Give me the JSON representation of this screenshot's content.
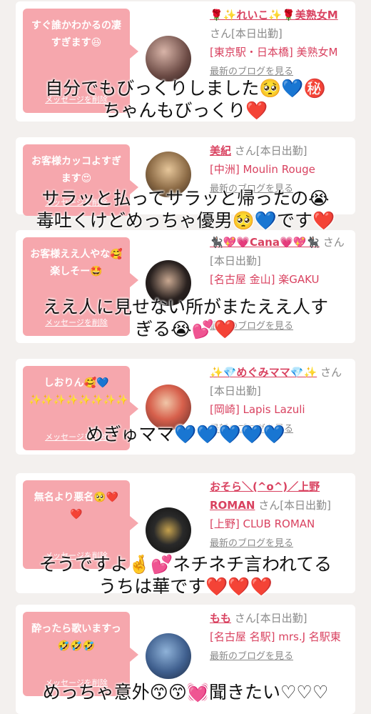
{
  "cards": [
    {
      "bubble": "すぐ誰かわかるの凄すぎます😆",
      "delete": "メッセージを削除",
      "name": "🌹✨れいこ✨🌹美熟女M",
      "suffix": "さん[本日出勤]",
      "location": "[東京駅・日本橋] 美熟女M",
      "blog": "最新のブログを見る"
    },
    {
      "bubble": "お客様カッコよすぎます😍",
      "delete": "メッセージを削除",
      "name": "美紀",
      "suffix": "さん[本日出勤]",
      "location": "[中洲] Moulin Rouge",
      "blog": "最新のブログを見る"
    },
    {
      "bubble": "お客様ええ人やな🥰楽しそー🤩",
      "delete": "メッセージを削除",
      "name": "🐈‍⬛💖💗Cana💗💖🐈‍⬛",
      "suffix": "さん[本日出勤]",
      "location": "[名古屋 金山] 楽GAKU",
      "blog": "最新のブログを見る"
    },
    {
      "bubble": "しおりん🥰💙✨✨✨✨✨✨✨✨",
      "delete": "メッセージを削除",
      "name": "✨💎めぐみママ💎✨",
      "suffix": "さん[本日出勤]",
      "location": "[岡崎] Lapis Lazuli",
      "blog": "最新のブログを見る"
    },
    {
      "bubble": "無名より悪名🥺❤️❤️",
      "delete": "メッセージを削除",
      "name": "おそら＼(^o^)／上野ROMAN",
      "suffix": "さん[本日出勤]",
      "location": "[上野] CLUB ROMAN",
      "blog": "最新のブログを見る"
    },
    {
      "bubble": "酔ったら歌いますっ🤣🤣🤣",
      "delete": "メッセージを削除",
      "name": "もも",
      "suffix": "さん[本日出勤]",
      "location": "[名古屋 名駅] mrs.J 名駅東",
      "blog": "最新のブログを見る"
    }
  ],
  "captions": [
    "自分でもびっくりしました🥺💙㊙️ちゃんもびっくり❤️",
    "サラッと払ってサラッと帰ったの😭毒吐くけどめっちゃ優男🥺💙です❤️",
    "ええ人に見せない所がまたええ人すぎる😭💕❤️",
    "めぎゅママ💙💙💙💙💙",
    "そうですよ🤞💕ネチネチ言われてるうちは華です❤️❤️❤️",
    "めっちゃ意外😙😙💓聞きたい♡♡♡"
  ],
  "caption_lines": {
    "c1a": "自分でもびっくりしました🥺💙㊙️",
    "c1b": "ちゃんもびっくり❤️",
    "c2a": "サラッと払ってサラッと帰ったの😭",
    "c2b": "毒吐くけどめっちゃ優男🥺💙です❤️",
    "c3a": "ええ人に見せない所がまたええ人す",
    "c3b": "ぎる😭💕❤️",
    "c4a": "めぎゅママ💙💙💙💙💙",
    "c5a": "そうですよ🤞💕ネチネチ言われてる",
    "c5b": "うちは華です❤️❤️❤️",
    "c6a": "めっちゃ意外😙😙💓聞きたい♡♡♡"
  },
  "colors": {
    "accent": "#d94260",
    "bubble": "#f6a7ad",
    "background": "#f3f0ee"
  }
}
